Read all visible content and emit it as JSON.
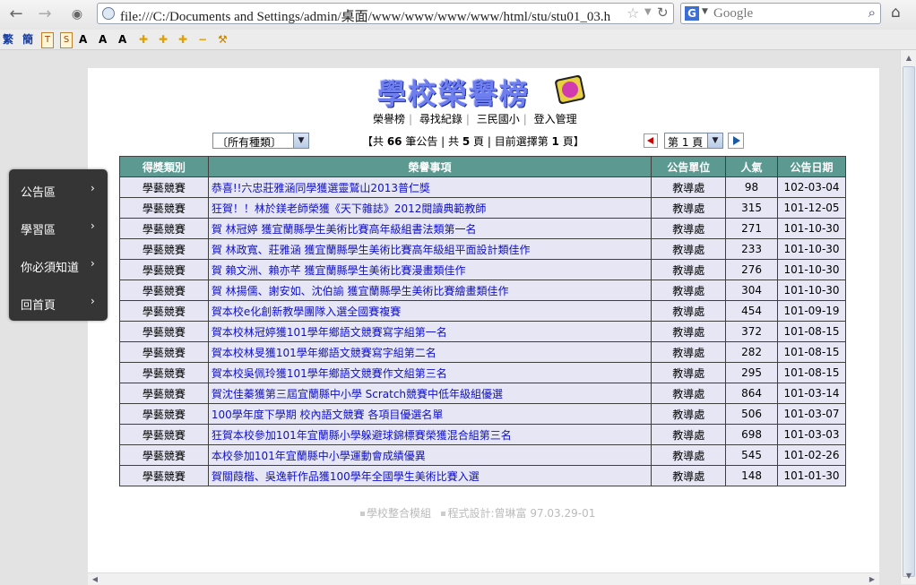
{
  "browser": {
    "url": "file:///C:/Documents and Settings/admin/桌面/www/www/www/www/html/stu/stu01_03.h",
    "search_engine": "G",
    "search_placeholder": "Google",
    "toolbar_items": [
      "繁",
      "簡",
      "T",
      "S",
      "A",
      "A",
      "A"
    ]
  },
  "header": {
    "title": "學校榮譽榜",
    "links": [
      "榮譽榜",
      "尋找紀錄",
      "三民國小",
      "登入管理"
    ]
  },
  "filters": {
    "category": "〔所有種類〕",
    "summary_prefix": "【共 ",
    "total": "66",
    "summary_mid1": " 筆公告 | 共 ",
    "pages": "5",
    "summary_mid2": " 頁 | 目前選擇第 ",
    "current": "1",
    "summary_suffix": " 頁】",
    "page_select": "第 1 頁"
  },
  "table": {
    "headers": [
      "得獎類別",
      "榮譽事項",
      "公告單位",
      "人氣",
      "公告日期"
    ],
    "rows": [
      {
        "cat": "學藝競賽",
        "title": "恭喜!!六忠莊雅涵同學獲選靈鷲山2013普仁獎",
        "unit": "教導處",
        "views": "98",
        "date": "102-03-04"
      },
      {
        "cat": "學藝競賽",
        "title": "狂賀！！林於鎂老師榮獲《天下雜誌》2012閱讀典範教師",
        "unit": "教導處",
        "views": "315",
        "date": "101-12-05"
      },
      {
        "cat": "學藝競賽",
        "title": "賀 林冠婷 獲宜蘭縣學生美術比賽高年級組書法類第一名",
        "unit": "教導處",
        "views": "271",
        "date": "101-10-30"
      },
      {
        "cat": "學藝競賽",
        "title": "賀 林政寬、莊雅涵 獲宜蘭縣學生美術比賽高年級組平面設計類佳作",
        "unit": "教導處",
        "views": "233",
        "date": "101-10-30"
      },
      {
        "cat": "學藝競賽",
        "title": "賀 賴文洲、賴亦芊 獲宜蘭縣學生美術比賽漫畫類佳作",
        "unit": "教導處",
        "views": "276",
        "date": "101-10-30"
      },
      {
        "cat": "學藝競賽",
        "title": "賀 林揚儒、謝安如、沈伯諭 獲宜蘭縣學生美術比賽繪畫類佳作",
        "unit": "教導處",
        "views": "304",
        "date": "101-10-30"
      },
      {
        "cat": "學藝競賽",
        "title": "賀本校e化創新教學團隊入選全國賽複賽",
        "unit": "教導處",
        "views": "454",
        "date": "101-09-19"
      },
      {
        "cat": "學藝競賽",
        "title": "賀本校林冠婷獲101學年鄉語文競賽寫字組第一名",
        "unit": "教導處",
        "views": "372",
        "date": "101-08-15"
      },
      {
        "cat": "學藝競賽",
        "title": "賀本校林旻獲101學年鄉語文競賽寫字組第二名",
        "unit": "教導處",
        "views": "282",
        "date": "101-08-15"
      },
      {
        "cat": "學藝競賽",
        "title": "賀本校吳佩玲獲101學年鄉語文競賽作文組第三名",
        "unit": "教導處",
        "views": "295",
        "date": "101-08-15"
      },
      {
        "cat": "學藝競賽",
        "title": "賀沈佳蓁獲第三屆宜蘭縣中小學 Scratch競賽中低年級組優選",
        "unit": "教導處",
        "views": "864",
        "date": "101-03-14"
      },
      {
        "cat": "學藝競賽",
        "title": "100學年度下學期 校內語文競賽 各項目優選名單",
        "unit": "教導處",
        "views": "506",
        "date": "101-03-07"
      },
      {
        "cat": "學藝競賽",
        "title": "狂賀本校參加101年宜蘭縣小學躲避球錦標賽榮獲混合組第三名",
        "unit": "教導處",
        "views": "698",
        "date": "101-03-03"
      },
      {
        "cat": "學藝競賽",
        "title": "本校參加101年宜蘭縣中小學運動會成績優異",
        "unit": "教導處",
        "views": "545",
        "date": "101-02-26"
      },
      {
        "cat": "學藝競賽",
        "title": "賀關葭楷、吳逸軒作品獲100學年全國學生美術比賽入選",
        "unit": "教導處",
        "views": "148",
        "date": "101-01-30"
      }
    ]
  },
  "footer": {
    "module": "學校整合模組",
    "credit": "程式設計:曾琳富 97.03.29-01"
  },
  "side_menu": [
    "公告區",
    "學習區",
    "你必須知道",
    "回首頁"
  ]
}
